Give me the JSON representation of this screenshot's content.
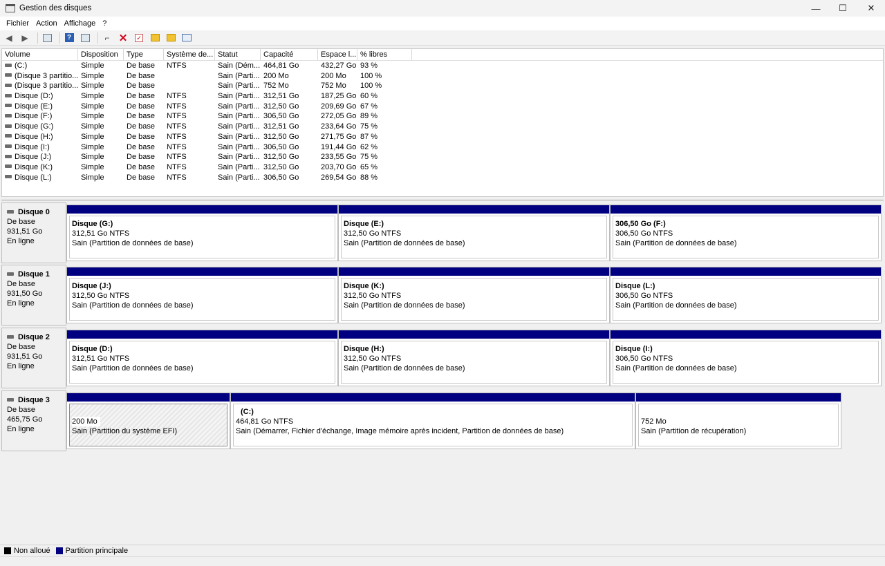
{
  "window": {
    "title": "Gestion des disques",
    "minimize": "—",
    "maximize": "☐",
    "close": "✕"
  },
  "menu": [
    "Fichier",
    "Action",
    "Affichage",
    "?"
  ],
  "volume_table": {
    "columns": [
      "Volume",
      "Disposition",
      "Type",
      "Système de...",
      "Statut",
      "Capacité",
      "Espace l...",
      "% libres"
    ],
    "rows": [
      [
        "(C:)",
        "Simple",
        "De base",
        "NTFS",
        "Sain (Dém...",
        "464,81 Go",
        "432,27 Go",
        "93 %"
      ],
      [
        "(Disque 3 partitio...",
        "Simple",
        "De base",
        "",
        "Sain (Parti...",
        "200 Mo",
        "200 Mo",
        "100 %"
      ],
      [
        "(Disque 3 partitio...",
        "Simple",
        "De base",
        "",
        "Sain (Parti...",
        "752 Mo",
        "752 Mo",
        "100 %"
      ],
      [
        "Disque (D:)",
        "Simple",
        "De base",
        "NTFS",
        "Sain (Parti...",
        "312,51 Go",
        "187,25 Go",
        "60 %"
      ],
      [
        "Disque (E:)",
        "Simple",
        "De base",
        "NTFS",
        "Sain (Parti...",
        "312,50 Go",
        "209,69 Go",
        "67 %"
      ],
      [
        "Disque (F:)",
        "Simple",
        "De base",
        "NTFS",
        "Sain (Parti...",
        "306,50 Go",
        "272,05 Go",
        "89 %"
      ],
      [
        "Disque (G:)",
        "Simple",
        "De base",
        "NTFS",
        "Sain (Parti...",
        "312,51 Go",
        "233,64 Go",
        "75 %"
      ],
      [
        "Disque (H:)",
        "Simple",
        "De base",
        "NTFS",
        "Sain (Parti...",
        "312,50 Go",
        "271,75 Go",
        "87 %"
      ],
      [
        "Disque (I:)",
        "Simple",
        "De base",
        "NTFS",
        "Sain (Parti...",
        "306,50 Go",
        "191,44 Go",
        "62 %"
      ],
      [
        "Disque (J:)",
        "Simple",
        "De base",
        "NTFS",
        "Sain (Parti...",
        "312,50 Go",
        "233,55 Go",
        "75 %"
      ],
      [
        "Disque (K:)",
        "Simple",
        "De base",
        "NTFS",
        "Sain (Parti...",
        "312,50 Go",
        "203,70 Go",
        "65 %"
      ],
      [
        "Disque (L:)",
        "Simple",
        "De base",
        "NTFS",
        "Sain (Parti...",
        "306,50 Go",
        "269,54 Go",
        "88 %"
      ]
    ]
  },
  "disks": [
    {
      "name": "Disque 0",
      "type": "De base",
      "size": "931,51 Go",
      "state": "En ligne",
      "partitions": [
        {
          "name": "Disque  (G:)",
          "size": "312,51 Go NTFS",
          "status": "Sain (Partition de données de base)"
        },
        {
          "name": "Disque  (E:)",
          "size": "312,50 Go NTFS",
          "status": "Sain (Partition de données de base)"
        },
        {
          "name": "306,50 Go  (F:)",
          "size": "306,50 Go NTFS",
          "status": "Sain (Partition de données de base)"
        }
      ]
    },
    {
      "name": "Disque 1",
      "type": "De base",
      "size": "931,50 Go",
      "state": "En ligne",
      "partitions": [
        {
          "name": "Disque  (J:)",
          "size": "312,50 Go NTFS",
          "status": "Sain (Partition de données de base)"
        },
        {
          "name": "Disque  (K:)",
          "size": "312,50 Go NTFS",
          "status": "Sain (Partition de données de base)"
        },
        {
          "name": "Disque  (L:)",
          "size": "306,50 Go NTFS",
          "status": "Sain (Partition de données de base)"
        }
      ]
    },
    {
      "name": "Disque 2",
      "type": "De base",
      "size": "931,51 Go",
      "state": "En ligne",
      "partitions": [
        {
          "name": "Disque  (D:)",
          "size": "312,51 Go NTFS",
          "status": "Sain (Partition de données de base)"
        },
        {
          "name": "Disque  (H:)",
          "size": "312,50 Go NTFS",
          "status": "Sain (Partition de données de base)"
        },
        {
          "name": "Disque  (I:)",
          "size": "306,50 Go NTFS",
          "status": "Sain (Partition de données de base)"
        }
      ]
    },
    {
      "name": "Disque 3",
      "type": "De base",
      "size": "465,75 Go",
      "state": "En ligne",
      "partitions": [
        {
          "name": "",
          "size": "200 Mo",
          "status": "Sain (Partition du système EFI)"
        },
        {
          "name": "(C:)",
          "size": "464,81 Go NTFS",
          "status": "Sain (Démarrer, Fichier d'échange, Image mémoire après incident, Partition de données de base)"
        },
        {
          "name": "",
          "size": "752 Mo",
          "status": "Sain (Partition de récupération)"
        }
      ]
    }
  ],
  "legend": [
    {
      "label": "Non alloué",
      "color": "#000000"
    },
    {
      "label": "Partition principale",
      "color": "#000080"
    }
  ]
}
